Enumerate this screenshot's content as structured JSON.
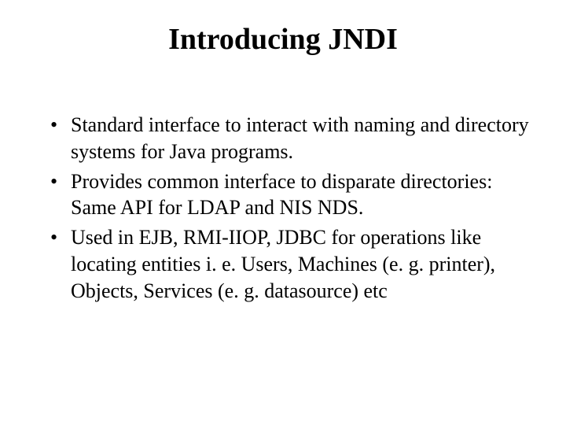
{
  "slide": {
    "title": "Introducing JNDI",
    "bullets": [
      "Standard interface to interact with naming and directory systems for Java programs.",
      "Provides common interface to disparate directories: Same API for LDAP and NIS NDS.",
      "Used in EJB, RMI-IIOP, JDBC for operations like locating entities i. e. Users, Machines (e. g. printer), Objects, Services (e. g. datasource) etc"
    ]
  }
}
